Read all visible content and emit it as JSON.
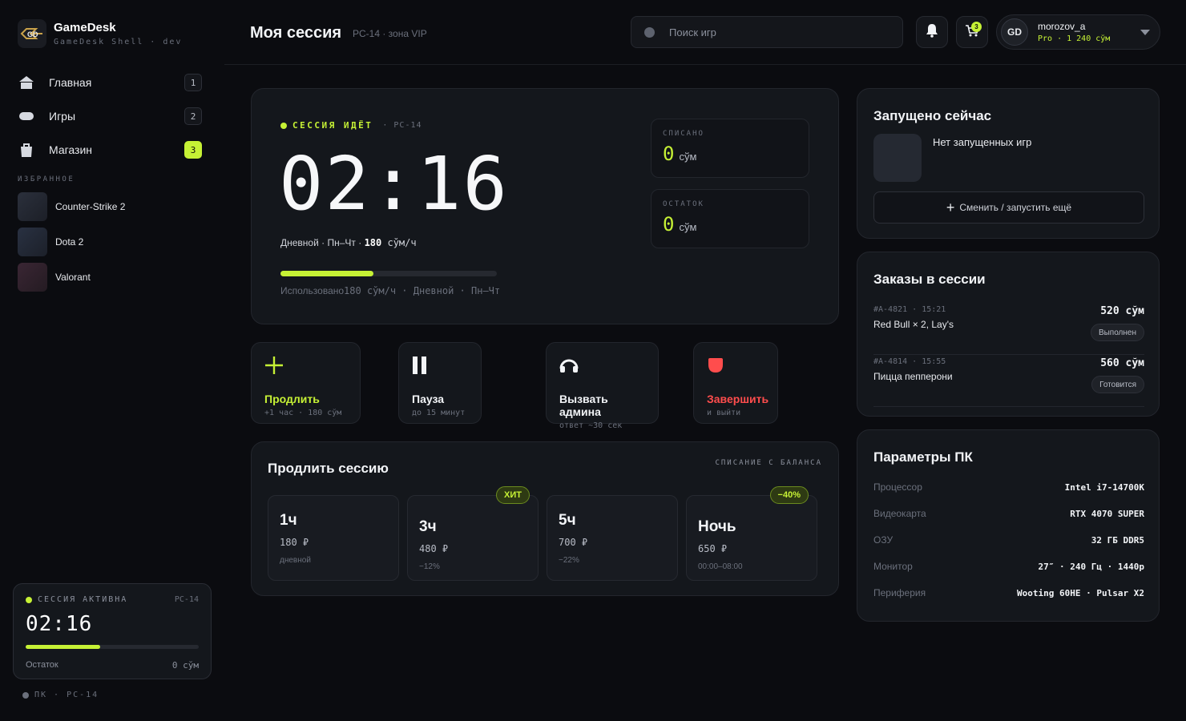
{
  "brand": {
    "title": "GameDesk",
    "subtitle": "GameDesk Shell · dev"
  },
  "nav": [
    {
      "label": "Главная",
      "count": "1",
      "icon": "home-icon"
    },
    {
      "label": "Игры",
      "count": "2",
      "icon": "gamepad-icon"
    },
    {
      "label": "Магазин",
      "count": "3",
      "icon": "shop-bag-icon"
    }
  ],
  "favorites": {
    "title": "ИЗБРАННОЕ",
    "items": [
      {
        "label": "Counter-Strike 2",
        "color": "#2a2f3a"
      },
      {
        "label": "Dota 2",
        "color": "#283040"
      },
      {
        "label": "Valorant",
        "color": "#33242f"
      }
    ]
  },
  "mini_session": {
    "status": "СЕССИЯ АКТИВНА",
    "pc": "PC-14",
    "time": "02:16",
    "progress": 0.43,
    "remaining_label": "Остаток",
    "remaining_value": "0 сўм"
  },
  "pc_label": "ПК · PC-14",
  "header": {
    "title": "Моя сессия",
    "subtitle": "PC-14 · зона VIP",
    "search_placeholder": "Поиск игр",
    "cart_count": "3",
    "user": {
      "initials": "GD",
      "name": "morozov_a",
      "meta": "Pro · 1 240 сўм"
    }
  },
  "session": {
    "status": "СЕССИЯ ИДЁТ",
    "pc": "· PC-14",
    "time": "02:16",
    "tariff_prefix": "Дневной · Пн–Чт · ",
    "tariff_rate": "180",
    "tariff_unit": " сўм/ч",
    "progress": 0.43,
    "used_label": "Использовано",
    "used_detail": "180 сўм/ч · Дневной · Пн–Чт",
    "charged": {
      "label": "СПИСАНО",
      "value": "0",
      "unit": "сўм"
    },
    "remaining": {
      "label": "ОСТАТОК",
      "value": "0",
      "unit": "сўм"
    }
  },
  "actions": [
    {
      "title": "Продлить",
      "sub": "+1 час · 180 сўм",
      "icon": "plus-icon",
      "color": "#c6f135"
    },
    {
      "title": "Пауза",
      "sub": "до 15 минут",
      "icon": "pause-icon",
      "color": "#f2f4f7"
    },
    {
      "title": "Вызвать админа",
      "sub": "ответ ~30 сек",
      "icon": "headset-icon",
      "color": "#f2f4f7"
    },
    {
      "title": "Завершить",
      "sub": "и выйти",
      "icon": "stop-icon",
      "color": "#ff4d4d"
    }
  ],
  "extend": {
    "title": "Продлить сессию",
    "note": "СПИСАНИЕ С БАЛАНСА",
    "plans": [
      {
        "name": "1ч",
        "price": "180 ₽",
        "note": "дневной",
        "badge": ""
      },
      {
        "name": "3ч",
        "price": "480 ₽",
        "note": "−12%",
        "badge": "ХИТ"
      },
      {
        "name": "5ч",
        "price": "700 ₽",
        "note": "−22%",
        "badge": ""
      },
      {
        "name": "Ночь",
        "price": "650 ₽",
        "note": "00:00–08:00",
        "badge": "−40%"
      }
    ]
  },
  "running": {
    "title": "Запущено сейчас",
    "empty_text": "Нет запущенных игр",
    "button": "Сменить / запустить ещё"
  },
  "orders": {
    "title": "Заказы в сессии",
    "items": [
      {
        "id": "#A-4821 · 15:21",
        "name": "Red Bull × 2, Lay's",
        "sum": "520 сўм",
        "status": "Выполнен"
      },
      {
        "id": "#A-4814 · 15:55",
        "name": "Пицца пепперони",
        "sum": "560 сўм",
        "status": "Готовится"
      }
    ]
  },
  "specs": {
    "title": "Параметры ПК",
    "items": [
      {
        "key": "Процессор",
        "value": "Intel i7-14700K"
      },
      {
        "key": "Видеокарта",
        "value": "RTX 4070 SUPER"
      },
      {
        "key": "ОЗУ",
        "value": "32 ГБ DDR5"
      },
      {
        "key": "Монитор",
        "value": "27″ · 240 Гц · 1440p"
      },
      {
        "key": "Периферия",
        "value": "Wooting 60HE · Pulsar X2"
      }
    ]
  },
  "colors": {
    "accent": "#c6f135",
    "danger": "#ff4d4d",
    "background": "#0b0c10",
    "card": "#14171c"
  }
}
